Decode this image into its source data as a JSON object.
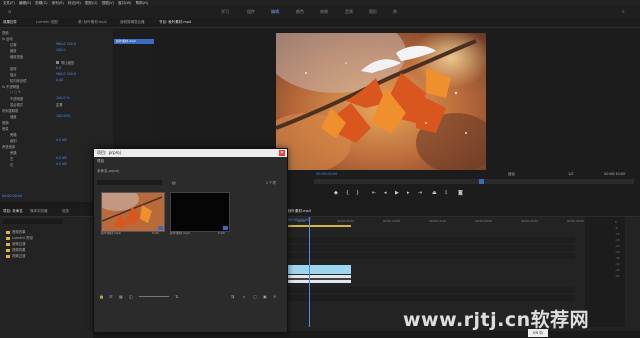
{
  "menubar": [
    "文件(F)",
    "编辑(E)",
    "剪辑(C)",
    "序列(S)",
    "标记(M)",
    "图形(G)",
    "视图(V)",
    "窗口(W)",
    "帮助(H)"
  ],
  "workspaces": [
    {
      "label": "学习",
      "active": false
    },
    {
      "label": "组件",
      "active": false
    },
    {
      "label": "编辑",
      "active": true
    },
    {
      "label": "颜色",
      "active": false
    },
    {
      "label": "效果",
      "active": false
    },
    {
      "label": "音频",
      "active": false
    },
    {
      "label": "图形",
      "active": false
    },
    {
      "label": "库",
      "active": false
    }
  ],
  "effect_controls": {
    "tabs": [
      "效果控件",
      "Lumetri 范围",
      "源: 秋叶素材.mp4",
      "音频剪辑混合器"
    ],
    "clip_label": "秋叶素材.mp4",
    "rows": [
      {
        "label": "视频",
        "value": ""
      },
      {
        "label": "fx 运动",
        "value": ""
      },
      {
        "label": "位置",
        "value": "960.0  540.0"
      },
      {
        "label": "缩放",
        "value": "100.0"
      },
      {
        "label": "缩放宽度",
        "value": ""
      },
      {
        "label": "等比缩放",
        "value": "✔"
      },
      {
        "label": "旋转",
        "value": "0.0"
      },
      {
        "label": "锚点",
        "value": "960.0  540.0"
      },
      {
        "label": "防闪烁滤镜",
        "value": "0.00"
      },
      {
        "label": "fx 不透明度",
        "value": ""
      },
      {
        "label": "不透明度",
        "value": "100.0 %"
      },
      {
        "label": "混合模式",
        "value": "正常"
      },
      {
        "label": "时间重映射",
        "value": ""
      },
      {
        "label": "速度",
        "value": "100.00%"
      },
      {
        "label": "音频",
        "value": ""
      },
      {
        "label": "音量",
        "value": ""
      },
      {
        "label": "旁路",
        "value": ""
      },
      {
        "label": "级别",
        "value": "0.0 dB"
      },
      {
        "label": "声道音量",
        "value": ""
      },
      {
        "label": "旁路",
        "value": ""
      },
      {
        "label": "左",
        "value": "0.0 dB"
      },
      {
        "label": "右",
        "value": "0.0 dB"
      }
    ],
    "timecode": "00:00:00:00"
  },
  "program_monitor": {
    "tab": "节目: 秋叶素材.mp4",
    "timecode": "00:00:00:00",
    "fit": "适合",
    "ratio": "1/2",
    "duration": "00:00:10:00"
  },
  "project_panel": {
    "tabs": [
      "项目: 未命名",
      "媒体浏览器",
      "库",
      "信息",
      "效果"
    ],
    "items": [
      "音频效果",
      "Lumetri 预设",
      "音频过渡",
      "视频效果",
      "视频过渡"
    ]
  },
  "dialog": {
    "title": "项目: .prproj",
    "subtitle": "项目",
    "path": "未命名.prproj",
    "count": "2 个项",
    "clips": [
      {
        "name": "秋叶素材.mp4",
        "duration": "5:00"
      },
      {
        "name": "秋叶素材.mp4",
        "duration": "5:00"
      }
    ]
  },
  "timeline": {
    "tab": "秋叶素材.mp4",
    "timecode": "00:00:00:00",
    "ruler": [
      "00:00",
      "00:00:05:00",
      "00:00:10:00",
      "00:00:15:00",
      "00:00:20:00",
      "00:00:25:00",
      "00:00:30:00"
    ],
    "tracks": [
      "V3",
      "V2",
      "V1",
      "A1",
      "A2",
      "A3",
      "主声道"
    ]
  },
  "watermark": "www.rjtj.cn软荐网",
  "status": {
    "lang": "EN",
    "ime": "中"
  }
}
